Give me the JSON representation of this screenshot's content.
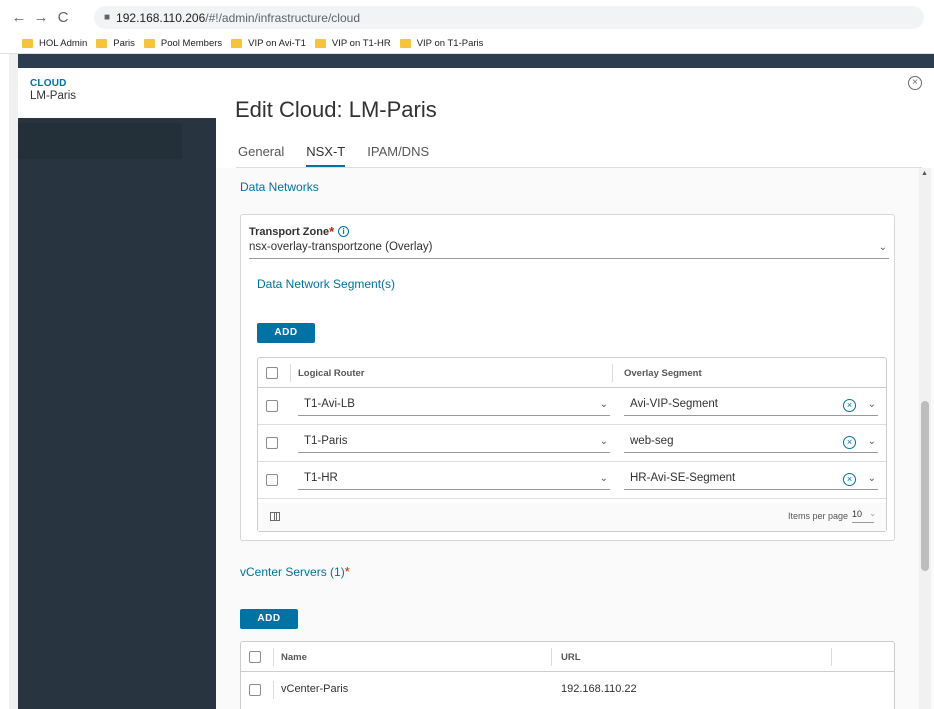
{
  "browser": {
    "back_glyph": "←",
    "forward_glyph": "→",
    "reload_glyph": "C",
    "url_host": "192.168.110.206",
    "url_path": "/#!/admin/infrastructure/cloud",
    "bookmarks": [
      {
        "label": "HOL Admin",
        "icon": "folder-icon"
      },
      {
        "label": "Paris",
        "icon": "folder-icon"
      },
      {
        "label": "Pool Members",
        "icon": "folder-icon"
      },
      {
        "label": "VIP on Avi-T1",
        "icon": "folder-icon"
      },
      {
        "label": "VIP on T1-HR",
        "icon": "folder-icon"
      },
      {
        "label": "VIP on T1-Paris",
        "icon": "folder-icon"
      }
    ]
  },
  "sidebar": {
    "kicker": "CLOUD",
    "name": "LM-Paris"
  },
  "modal": {
    "title": "Edit Cloud: LM-Paris",
    "close_glyph": "×",
    "tabs": [
      {
        "label": "General",
        "active": false
      },
      {
        "label": "NSX-T",
        "active": true
      },
      {
        "label": "IPAM/DNS",
        "active": false
      }
    ]
  },
  "data_networks": {
    "title": "Data Networks",
    "transport_zone_label": "Transport Zone",
    "transport_zone_value": "nsx-overlay-transportzone (Overlay)",
    "segments_title": "Data Network Segment(s)",
    "add_label": "ADD",
    "columns": [
      "Logical Router",
      "Overlay Segment"
    ],
    "rows": [
      {
        "router": "T1-Avi-LB",
        "segment": "Avi-VIP-Segment"
      },
      {
        "router": "T1-Paris",
        "segment": "web-seg"
      },
      {
        "router": "T1-HR",
        "segment": "HR-Avi-SE-Segment"
      }
    ],
    "items_per_page_label": "Items per page",
    "items_per_page_value": "10"
  },
  "vcenter": {
    "title": "vCenter Servers (1)",
    "add_label": "ADD",
    "columns": [
      "Name",
      "URL"
    ],
    "rows": [
      {
        "name": "vCenter-Paris",
        "url": "192.168.110.22"
      }
    ]
  },
  "glyphs": {
    "chevron": "⌄",
    "required": "*",
    "info": "i",
    "clear": "×",
    "lock": "🔒"
  },
  "colors": {
    "accent": "#0072a3",
    "sidebar": "#283440",
    "required": "#c21d00"
  }
}
